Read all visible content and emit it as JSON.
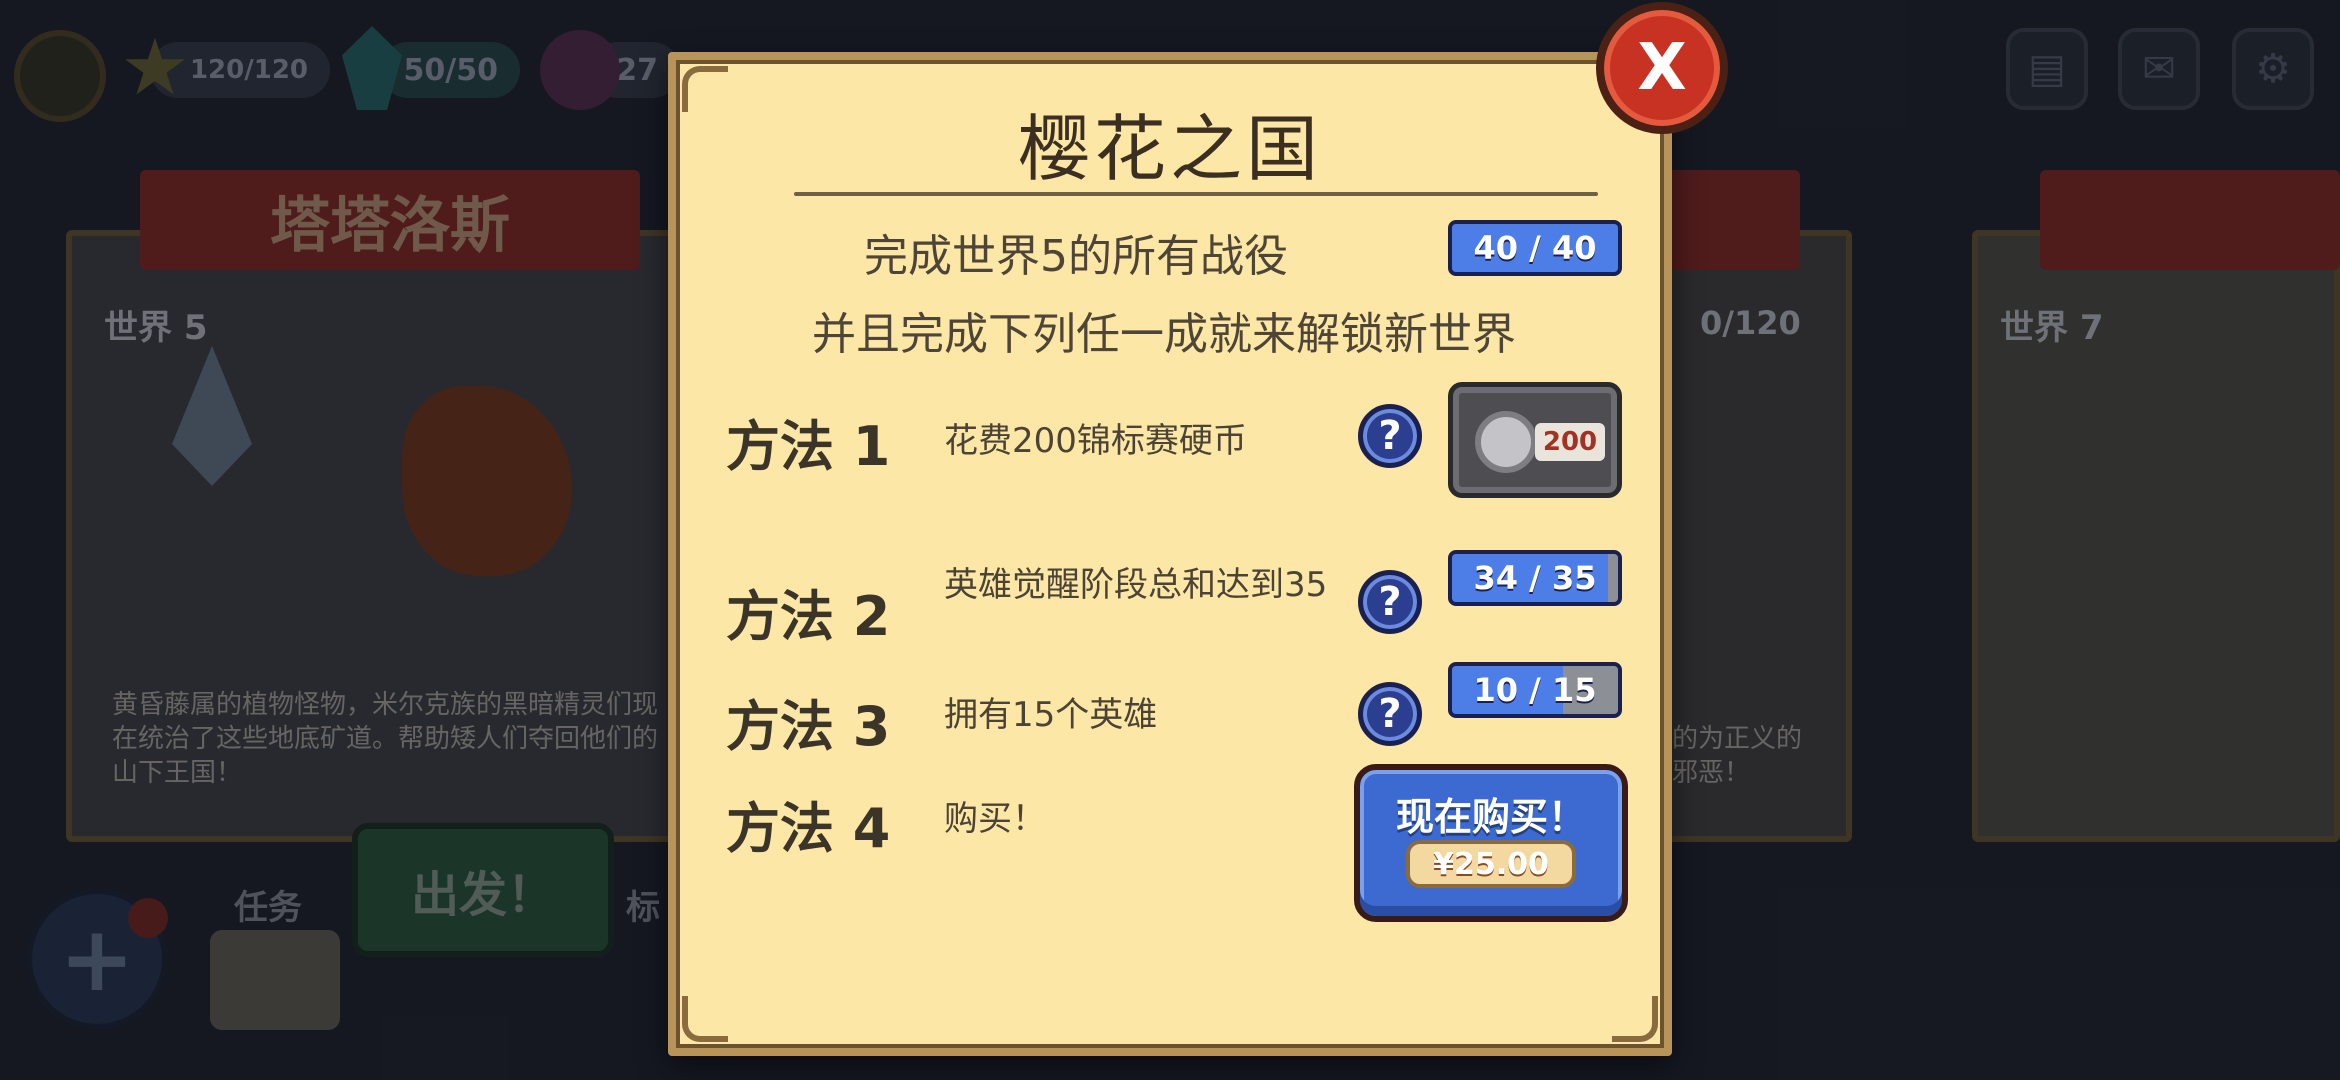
{
  "hud": {
    "stars": "120/120",
    "gems": "50/50",
    "potions": "27"
  },
  "background": {
    "left_card": {
      "ribbon_title": "塔塔洛斯",
      "world_label": "世界 5",
      "description": "黄昏藤属的植物怪物，米尔克族的黑暗精灵们现在统治了这些地底矿道。帮助矮人们夺回他们的山下王国！"
    },
    "mid_card": {
      "stars": "0/120",
      "description": "的为正义的邪恶！"
    },
    "right_card": {
      "world_label": "世界 7"
    },
    "go_button": "出发！",
    "tab_tasks": "任务",
    "tab_partial": "标"
  },
  "modal": {
    "title": "樱花之国",
    "requirement_line1": "完成世界5的所有战役",
    "requirement_progress": "40 / 40",
    "requirement_line2": "并且完成下列任一成就来解锁新世界",
    "methods": [
      {
        "label": "方法 1",
        "desc": "花费200锦标赛硬币",
        "coin_value": "200"
      },
      {
        "label": "方法 2",
        "desc": "英雄觉醒阶段总和达到35",
        "progress": "34 / 35",
        "ratio": 0.9714
      },
      {
        "label": "方法 3",
        "desc": "拥有15个英雄",
        "progress": "10 / 15",
        "ratio": 0.6667
      },
      {
        "label": "方法 4",
        "desc": "购买！"
      }
    ],
    "buy_button": {
      "label": "现在购买！",
      "price": "¥25.00"
    },
    "close_label": "X",
    "help_symbol": "?"
  },
  "colors": {
    "modal_bg": "#fde7a6",
    "progress_blue": "#4d7de6",
    "close_red": "#c83222",
    "buy_blue": "#3c6ad0"
  }
}
